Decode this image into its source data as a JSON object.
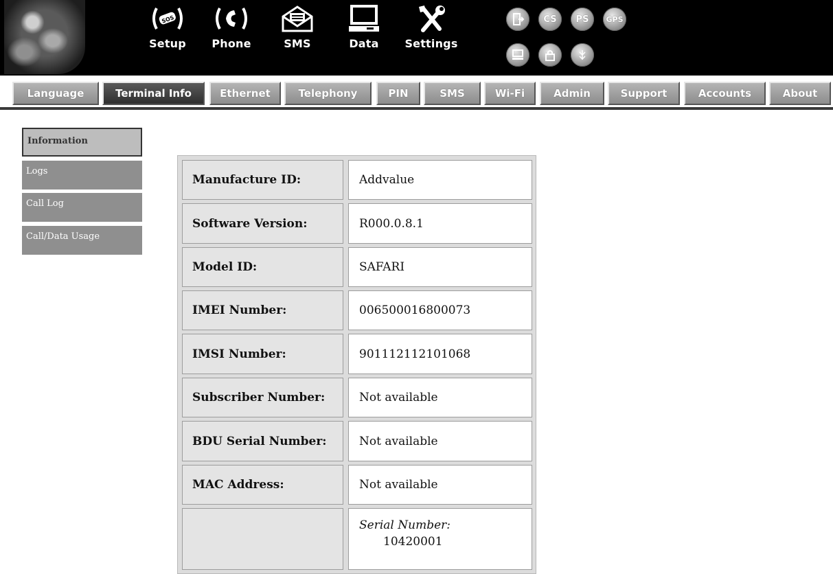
{
  "main_nav": [
    {
      "label": "Setup",
      "icon": "sos-setup-icon"
    },
    {
      "label": "Phone",
      "icon": "phone-icon"
    },
    {
      "label": "SMS",
      "icon": "envelope-icon"
    },
    {
      "label": "Data",
      "icon": "computer-icon"
    },
    {
      "label": "Settings",
      "icon": "tools-icon"
    }
  ],
  "status_indicators": [
    {
      "name": "exit-indicator-icon"
    },
    {
      "label": "CS",
      "name": "cs-indicator"
    },
    {
      "label": "PS",
      "name": "ps-indicator"
    },
    {
      "label": "GPS",
      "name": "gps-indicator"
    },
    {
      "name": "computer-indicator-icon"
    },
    {
      "name": "lock-indicator-icon"
    },
    {
      "name": "signal-indicator-icon"
    }
  ],
  "tabs": [
    {
      "label": "Language",
      "active": false
    },
    {
      "label": "Terminal Info",
      "active": true
    },
    {
      "label": "Ethernet",
      "active": false
    },
    {
      "label": "Telephony",
      "active": false
    },
    {
      "label": "PIN",
      "active": false
    },
    {
      "label": "SMS",
      "active": false
    },
    {
      "label": "Wi-Fi",
      "active": false
    },
    {
      "label": "Admin",
      "active": false
    },
    {
      "label": "Support",
      "active": false
    },
    {
      "label": "Accounts",
      "active": false
    },
    {
      "label": "About",
      "active": false
    }
  ],
  "side_menu": [
    {
      "label": "Information",
      "active": true
    },
    {
      "label": "Logs",
      "active": false
    },
    {
      "label": "Call Log",
      "active": false
    },
    {
      "label": "Call/Data Usage",
      "active": false
    }
  ],
  "info_rows": [
    {
      "label": "Manufacture ID:",
      "value": "Addvalue"
    },
    {
      "label": "Software Version:",
      "value": "R000.0.8.1"
    },
    {
      "label": "Model ID:",
      "value": "SAFARI"
    },
    {
      "label": "IMEI Number:",
      "value": "006500016800073"
    },
    {
      "label": "IMSI Number:",
      "value": "901112112101068"
    },
    {
      "label": "Subscriber Number:",
      "value": "Not available"
    },
    {
      "label": "BDU Serial Number:",
      "value": "Not available"
    },
    {
      "label": "MAC Address:",
      "value": "Not available"
    }
  ],
  "serial_row": {
    "label": "",
    "value_label": "Serial Number:",
    "value": "10420001"
  }
}
